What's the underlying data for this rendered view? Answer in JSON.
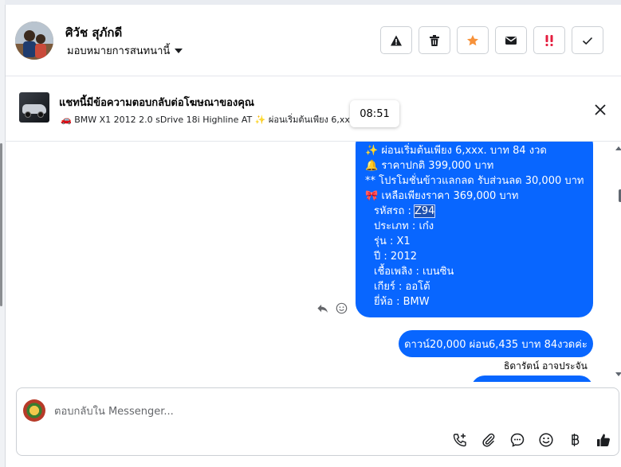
{
  "header": {
    "user_name": "ศิวัช สุภักดี",
    "assign_label": "มอบหมายการสนทนานี้",
    "actions": [
      {
        "name": "report-button",
        "icon": "warning-icon"
      },
      {
        "name": "delete-button",
        "icon": "trash-icon"
      },
      {
        "name": "star-button",
        "icon": "star-icon",
        "color": "#f7923a"
      },
      {
        "name": "mark-unread-button",
        "icon": "envelope-icon"
      },
      {
        "name": "follow-up-button",
        "icon": "double-exclamation-icon",
        "color": "#e41e3f"
      },
      {
        "name": "mark-done-button",
        "icon": "check-icon"
      }
    ]
  },
  "banner": {
    "title": "แชทนี้มีข้อความตอบกลับต่อโฆษณาของคุณ",
    "subtitle": "🚗 BMW X1 2012 2.0 sDrive 18i Highline AT ✨ ผ่อนเริ่มต้นเพียง 6,xx..."
  },
  "tooltip_time": "08:51",
  "message": {
    "lines": [
      "✨  ผ่อนเริ่มต้นเพียง 6,xxx. บาท 84 งวด",
      "🔔  ราคาปกติ 399,000 บาท",
      "** โปรโมชั่นข้าวแลกลด รับส่วนลด 30,000 บาท",
      "🎀  เหลือเพียงราคา 369,000 บาท"
    ],
    "code_label": "รหัสรถ : ",
    "code_value": "Z94",
    "details": [
      "ประเภท : เก๋ง",
      "รุ่น : X1",
      "ปี : 2012",
      "เชื้อเพลิง : เบนซิน",
      "เกียร์ : ออโต้",
      "ยี่ห้อ : BMW"
    ]
  },
  "message2": "ดาวน์20,000 ผ่อน6,435 บาท 84งวดค่ะ",
  "sender_name": "ธิดารัตน์ อาจประจัน",
  "composer": {
    "placeholder": "ตอบกลับใน Messenger..."
  },
  "colors": {
    "bubble": "#0866ff",
    "accent_star": "#f7923a",
    "accent_alert": "#e41e3f"
  }
}
